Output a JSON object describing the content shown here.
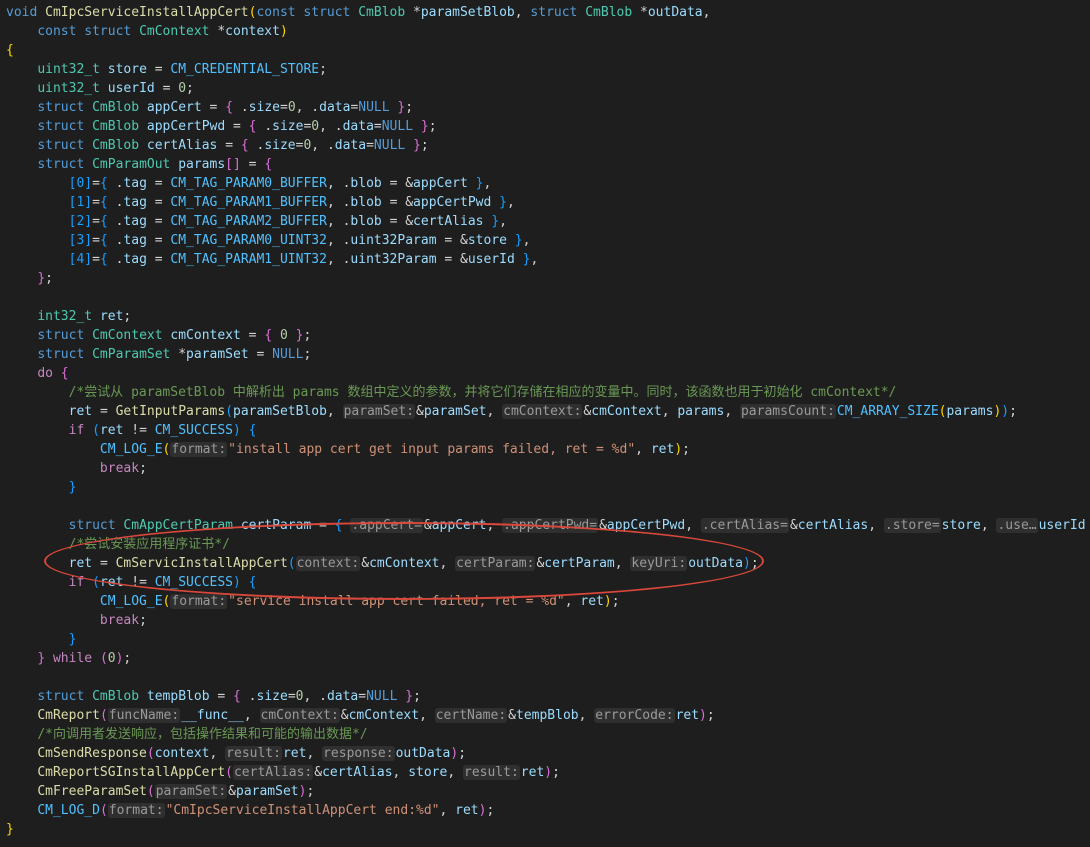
{
  "colors": {
    "kw": "#569cd6",
    "type": "#4ec9b0",
    "fn": "#dcdcaa",
    "var": "#9cdcfe",
    "macro": "#4fc1ff",
    "str": "#ce9178",
    "num": "#b5cea8",
    "comment": "#6a9955",
    "ctrl": "#c586c0",
    "plain": "#d4d4d4",
    "brace1": "#ffd700",
    "brace2": "#da70d6",
    "brace3": "#179fff",
    "annotation": "#d9483b"
  },
  "lines": [
    [
      [
        "kw",
        "void "
      ],
      [
        "fn",
        "CmIpcServiceInstallAppCert"
      ],
      [
        "brace1",
        "("
      ],
      [
        "kw",
        "const struct "
      ],
      [
        "type",
        "CmBlob "
      ],
      [
        "plain",
        "*"
      ],
      [
        "var",
        "paramSetBlob"
      ],
      [
        "plain",
        ", "
      ],
      [
        "kw",
        "struct "
      ],
      [
        "type",
        "CmBlob "
      ],
      [
        "plain",
        "*"
      ],
      [
        "var",
        "outData"
      ],
      [
        "plain",
        ","
      ]
    ],
    [
      [
        "plain",
        "    "
      ],
      [
        "kw",
        "const struct "
      ],
      [
        "type",
        "CmContext "
      ],
      [
        "plain",
        "*"
      ],
      [
        "var",
        "context"
      ],
      [
        "brace1",
        ")"
      ]
    ],
    [
      [
        "brace1",
        "{"
      ]
    ],
    [
      [
        "plain",
        "    "
      ],
      [
        "type",
        "uint32_t "
      ],
      [
        "var",
        "store "
      ],
      [
        "plain",
        "= "
      ],
      [
        "macro",
        "CM_CREDENTIAL_STORE"
      ],
      [
        "plain",
        ";"
      ]
    ],
    [
      [
        "plain",
        "    "
      ],
      [
        "type",
        "uint32_t "
      ],
      [
        "var",
        "userId "
      ],
      [
        "plain",
        "= "
      ],
      [
        "num",
        "0"
      ],
      [
        "plain",
        ";"
      ]
    ],
    [
      [
        "plain",
        "    "
      ],
      [
        "kw",
        "struct "
      ],
      [
        "type",
        "CmBlob "
      ],
      [
        "var",
        "appCert "
      ],
      [
        "plain",
        "= "
      ],
      [
        "brace2",
        "{ "
      ],
      [
        "plain",
        "."
      ],
      [
        "var",
        "size"
      ],
      [
        "plain",
        "="
      ],
      [
        "num",
        "0"
      ],
      [
        "plain",
        ", ."
      ],
      [
        "var",
        "data"
      ],
      [
        "plain",
        "="
      ],
      [
        "kw",
        "NULL "
      ],
      [
        "brace2",
        "}"
      ],
      [
        "plain",
        ";"
      ]
    ],
    [
      [
        "plain",
        "    "
      ],
      [
        "kw",
        "struct "
      ],
      [
        "type",
        "CmBlob "
      ],
      [
        "var",
        "appCertPwd "
      ],
      [
        "plain",
        "= "
      ],
      [
        "brace2",
        "{ "
      ],
      [
        "plain",
        "."
      ],
      [
        "var",
        "size"
      ],
      [
        "plain",
        "="
      ],
      [
        "num",
        "0"
      ],
      [
        "plain",
        ", ."
      ],
      [
        "var",
        "data"
      ],
      [
        "plain",
        "="
      ],
      [
        "kw",
        "NULL "
      ],
      [
        "brace2",
        "}"
      ],
      [
        "plain",
        ";"
      ]
    ],
    [
      [
        "plain",
        "    "
      ],
      [
        "kw",
        "struct "
      ],
      [
        "type",
        "CmBlob "
      ],
      [
        "var",
        "certAlias "
      ],
      [
        "plain",
        "= "
      ],
      [
        "brace2",
        "{ "
      ],
      [
        "plain",
        "."
      ],
      [
        "var",
        "size"
      ],
      [
        "plain",
        "="
      ],
      [
        "num",
        "0"
      ],
      [
        "plain",
        ", ."
      ],
      [
        "var",
        "data"
      ],
      [
        "plain",
        "="
      ],
      [
        "kw",
        "NULL "
      ],
      [
        "brace2",
        "}"
      ],
      [
        "plain",
        ";"
      ]
    ],
    [
      [
        "plain",
        "    "
      ],
      [
        "kw",
        "struct "
      ],
      [
        "type",
        "CmParamOut "
      ],
      [
        "var",
        "params"
      ],
      [
        "brace2",
        "[]"
      ],
      [
        "plain",
        " = "
      ],
      [
        "brace2",
        "{"
      ]
    ],
    [
      [
        "plain",
        "        "
      ],
      [
        "brace3",
        "[0]"
      ],
      [
        "plain",
        "="
      ],
      [
        "brace3",
        "{ "
      ],
      [
        "plain",
        "."
      ],
      [
        "var",
        "tag "
      ],
      [
        "plain",
        "= "
      ],
      [
        "macro",
        "CM_TAG_PARAM0_BUFFER"
      ],
      [
        "plain",
        ", ."
      ],
      [
        "var",
        "blob "
      ],
      [
        "plain",
        "= &"
      ],
      [
        "var",
        "appCert "
      ],
      [
        "brace3",
        "}"
      ],
      [
        "plain",
        ","
      ]
    ],
    [
      [
        "plain",
        "        "
      ],
      [
        "brace3",
        "[1]"
      ],
      [
        "plain",
        "="
      ],
      [
        "brace3",
        "{ "
      ],
      [
        "plain",
        "."
      ],
      [
        "var",
        "tag "
      ],
      [
        "plain",
        "= "
      ],
      [
        "macro",
        "CM_TAG_PARAM1_BUFFER"
      ],
      [
        "plain",
        ", ."
      ],
      [
        "var",
        "blob "
      ],
      [
        "plain",
        "= &"
      ],
      [
        "var",
        "appCertPwd "
      ],
      [
        "brace3",
        "}"
      ],
      [
        "plain",
        ","
      ]
    ],
    [
      [
        "plain",
        "        "
      ],
      [
        "brace3",
        "[2]"
      ],
      [
        "plain",
        "="
      ],
      [
        "brace3",
        "{ "
      ],
      [
        "plain",
        "."
      ],
      [
        "var",
        "tag "
      ],
      [
        "plain",
        "= "
      ],
      [
        "macro",
        "CM_TAG_PARAM2_BUFFER"
      ],
      [
        "plain",
        ", ."
      ],
      [
        "var",
        "blob "
      ],
      [
        "plain",
        "= &"
      ],
      [
        "var",
        "certAlias "
      ],
      [
        "brace3",
        "}"
      ],
      [
        "plain",
        ","
      ]
    ],
    [
      [
        "plain",
        "        "
      ],
      [
        "brace3",
        "[3]"
      ],
      [
        "plain",
        "="
      ],
      [
        "brace3",
        "{ "
      ],
      [
        "plain",
        "."
      ],
      [
        "var",
        "tag "
      ],
      [
        "plain",
        "= "
      ],
      [
        "macro",
        "CM_TAG_PARAM0_UINT32"
      ],
      [
        "plain",
        ", ."
      ],
      [
        "var",
        "uint32Param "
      ],
      [
        "plain",
        "= &"
      ],
      [
        "var",
        "store "
      ],
      [
        "brace3",
        "}"
      ],
      [
        "plain",
        ","
      ]
    ],
    [
      [
        "plain",
        "        "
      ],
      [
        "brace3",
        "[4]"
      ],
      [
        "plain",
        "="
      ],
      [
        "brace3",
        "{ "
      ],
      [
        "plain",
        "."
      ],
      [
        "var",
        "tag "
      ],
      [
        "plain",
        "= "
      ],
      [
        "macro",
        "CM_TAG_PARAM1_UINT32"
      ],
      [
        "plain",
        ", ."
      ],
      [
        "var",
        "uint32Param "
      ],
      [
        "plain",
        "= &"
      ],
      [
        "var",
        "userId "
      ],
      [
        "brace3",
        "}"
      ],
      [
        "plain",
        ","
      ]
    ],
    [
      [
        "plain",
        "    "
      ],
      [
        "brace2",
        "}"
      ],
      [
        "plain",
        ";"
      ]
    ],
    [],
    [
      [
        "plain",
        "    "
      ],
      [
        "type",
        "int32_t "
      ],
      [
        "var",
        "ret"
      ],
      [
        "plain",
        ";"
      ]
    ],
    [
      [
        "plain",
        "    "
      ],
      [
        "kw",
        "struct "
      ],
      [
        "type",
        "CmContext "
      ],
      [
        "var",
        "cmContext "
      ],
      [
        "plain",
        "= "
      ],
      [
        "brace2",
        "{ "
      ],
      [
        "num",
        "0 "
      ],
      [
        "brace2",
        "}"
      ],
      [
        "plain",
        ";"
      ]
    ],
    [
      [
        "plain",
        "    "
      ],
      [
        "kw",
        "struct "
      ],
      [
        "type",
        "CmParamSet "
      ],
      [
        "plain",
        "*"
      ],
      [
        "var",
        "paramSet "
      ],
      [
        "plain",
        "= "
      ],
      [
        "kw",
        "NULL"
      ],
      [
        "plain",
        ";"
      ]
    ],
    [
      [
        "plain",
        "    "
      ],
      [
        "ctrl",
        "do "
      ],
      [
        "brace2",
        "{"
      ]
    ],
    [
      [
        "plain",
        "        "
      ],
      [
        "comment",
        "/*尝试从 paramSetBlob 中解析出 params 数组中定义的参数，并将它们存储在相应的变量中。同时，该函数也用于初始化 cmContext*/"
      ]
    ],
    [
      [
        "plain",
        "        "
      ],
      [
        "var",
        "ret "
      ],
      [
        "plain",
        "= "
      ],
      [
        "fn",
        "GetInputParams"
      ],
      [
        "brace3",
        "("
      ],
      [
        "var",
        "paramSetBlob"
      ],
      [
        "plain",
        ", "
      ],
      [
        "hint",
        "paramSet:"
      ],
      [
        "plain",
        "&"
      ],
      [
        "var",
        "paramSet"
      ],
      [
        "plain",
        ", "
      ],
      [
        "hint",
        "cmContext:"
      ],
      [
        "plain",
        "&"
      ],
      [
        "var",
        "cmContext"
      ],
      [
        "plain",
        ", "
      ],
      [
        "var",
        "params"
      ],
      [
        "plain",
        ", "
      ],
      [
        "hint",
        "paramsCount:"
      ],
      [
        "macro",
        "CM_ARRAY_SIZE"
      ],
      [
        "brace1",
        "("
      ],
      [
        "var",
        "params"
      ],
      [
        "brace1",
        ")"
      ],
      [
        "brace3",
        ")"
      ],
      [
        "plain",
        ";"
      ]
    ],
    [
      [
        "plain",
        "        "
      ],
      [
        "ctrl",
        "if "
      ],
      [
        "brace3",
        "("
      ],
      [
        "var",
        "ret "
      ],
      [
        "plain",
        "!= "
      ],
      [
        "macro",
        "CM_SUCCESS"
      ],
      [
        "brace3",
        ") {"
      ]
    ],
    [
      [
        "plain",
        "            "
      ],
      [
        "macro",
        "CM_LOG_E"
      ],
      [
        "brace1",
        "("
      ],
      [
        "hint",
        "format:"
      ],
      [
        "str",
        "\"install app cert get input params failed, ret = %d\""
      ],
      [
        "plain",
        ", "
      ],
      [
        "var",
        "ret"
      ],
      [
        "brace1",
        ")"
      ],
      [
        "plain",
        ";"
      ]
    ],
    [
      [
        "plain",
        "            "
      ],
      [
        "ctrl",
        "break"
      ],
      [
        "plain",
        ";"
      ]
    ],
    [
      [
        "plain",
        "        "
      ],
      [
        "brace3",
        "}"
      ]
    ],
    [],
    [
      [
        "plain",
        "        "
      ],
      [
        "kw",
        "struct "
      ],
      [
        "type",
        "CmAppCertParam "
      ],
      [
        "var",
        "certParam "
      ],
      [
        "plain",
        "= "
      ],
      [
        "brace3",
        "{ "
      ],
      [
        "hint",
        ".appCert="
      ],
      [
        "plain",
        "&"
      ],
      [
        "var",
        "appCert"
      ],
      [
        "plain",
        ", "
      ],
      [
        "hint",
        ".appCertPwd="
      ],
      [
        "plain",
        "&"
      ],
      [
        "var",
        "appCertPwd"
      ],
      [
        "plain",
        ", "
      ],
      [
        "hint",
        ".certAlias="
      ],
      [
        "plain",
        "&"
      ],
      [
        "var",
        "certAlias"
      ],
      [
        "plain",
        ", "
      ],
      [
        "hint",
        ".store="
      ],
      [
        "var",
        "store"
      ],
      [
        "plain",
        ", "
      ],
      [
        "hint",
        ".use…"
      ],
      [
        "var",
        "userId "
      ],
      [
        "brace3",
        "}"
      ],
      [
        "plain",
        ";"
      ]
    ],
    [
      [
        "plain",
        "        "
      ],
      [
        "comment",
        "/*尝试安装应用程序证书*/"
      ]
    ],
    [
      [
        "plain",
        "        "
      ],
      [
        "var",
        "ret "
      ],
      [
        "plain",
        "= "
      ],
      [
        "fn",
        "CmServicInstallAppCert"
      ],
      [
        "brace3",
        "("
      ],
      [
        "hint",
        "context:"
      ],
      [
        "plain",
        "&"
      ],
      [
        "var",
        "cmContext"
      ],
      [
        "plain",
        ", "
      ],
      [
        "hint",
        "certParam:"
      ],
      [
        "plain",
        "&"
      ],
      [
        "var",
        "certParam"
      ],
      [
        "plain",
        ", "
      ],
      [
        "hint",
        "keyUri:"
      ],
      [
        "var",
        "outData"
      ],
      [
        "brace3",
        ")"
      ],
      [
        "plain",
        ";"
      ]
    ],
    [
      [
        "plain",
        "        "
      ],
      [
        "ctrl",
        "if "
      ],
      [
        "brace3",
        "("
      ],
      [
        "var",
        "ret "
      ],
      [
        "plain",
        "!= "
      ],
      [
        "macro",
        "CM_SUCCESS"
      ],
      [
        "brace3",
        ") {"
      ]
    ],
    [
      [
        "plain",
        "            "
      ],
      [
        "macro",
        "CM_LOG_E"
      ],
      [
        "brace1",
        "("
      ],
      [
        "hint",
        "format:"
      ],
      [
        "str",
        "\"service install app cert failed, ret = %d\""
      ],
      [
        "plain",
        ", "
      ],
      [
        "var",
        "ret"
      ],
      [
        "brace1",
        ")"
      ],
      [
        "plain",
        ";"
      ]
    ],
    [
      [
        "plain",
        "            "
      ],
      [
        "ctrl",
        "break"
      ],
      [
        "plain",
        ";"
      ]
    ],
    [
      [
        "plain",
        "        "
      ],
      [
        "brace3",
        "}"
      ]
    ],
    [
      [
        "plain",
        "    "
      ],
      [
        "brace2",
        "} "
      ],
      [
        "ctrl",
        "while "
      ],
      [
        "brace2",
        "("
      ],
      [
        "num",
        "0"
      ],
      [
        "brace2",
        ")"
      ],
      [
        "plain",
        ";"
      ]
    ],
    [],
    [
      [
        "plain",
        "    "
      ],
      [
        "kw",
        "struct "
      ],
      [
        "type",
        "CmBlob "
      ],
      [
        "var",
        "tempBlob "
      ],
      [
        "plain",
        "= "
      ],
      [
        "brace2",
        "{ "
      ],
      [
        "plain",
        "."
      ],
      [
        "var",
        "size"
      ],
      [
        "plain",
        "="
      ],
      [
        "num",
        "0"
      ],
      [
        "plain",
        ", ."
      ],
      [
        "var",
        "data"
      ],
      [
        "plain",
        "="
      ],
      [
        "kw",
        "NULL "
      ],
      [
        "brace2",
        "}"
      ],
      [
        "plain",
        ";"
      ]
    ],
    [
      [
        "plain",
        "    "
      ],
      [
        "fn",
        "CmReport"
      ],
      [
        "brace2",
        "("
      ],
      [
        "hint",
        "funcName:"
      ],
      [
        "var",
        "__func__"
      ],
      [
        "plain",
        ", "
      ],
      [
        "hint",
        "cmContext:"
      ],
      [
        "plain",
        "&"
      ],
      [
        "var",
        "cmContext"
      ],
      [
        "plain",
        ", "
      ],
      [
        "hint",
        "certName:"
      ],
      [
        "plain",
        "&"
      ],
      [
        "var",
        "tempBlob"
      ],
      [
        "plain",
        ", "
      ],
      [
        "hint",
        "errorCode:"
      ],
      [
        "var",
        "ret"
      ],
      [
        "brace2",
        ")"
      ],
      [
        "plain",
        ";"
      ]
    ],
    [
      [
        "plain",
        "    "
      ],
      [
        "comment",
        "/*向调用者发送响应，包括操作结果和可能的输出数据*/"
      ]
    ],
    [
      [
        "plain",
        "    "
      ],
      [
        "fn",
        "CmSendResponse"
      ],
      [
        "brace2",
        "("
      ],
      [
        "var",
        "context"
      ],
      [
        "plain",
        ", "
      ],
      [
        "hint",
        "result:"
      ],
      [
        "var",
        "ret"
      ],
      [
        "plain",
        ", "
      ],
      [
        "hint",
        "response:"
      ],
      [
        "var",
        "outData"
      ],
      [
        "brace2",
        ")"
      ],
      [
        "plain",
        ";"
      ]
    ],
    [
      [
        "plain",
        "    "
      ],
      [
        "fn",
        "CmReportSGInstallAppCert"
      ],
      [
        "brace2",
        "("
      ],
      [
        "hint",
        "certAlias:"
      ],
      [
        "plain",
        "&"
      ],
      [
        "var",
        "certAlias"
      ],
      [
        "plain",
        ", "
      ],
      [
        "var",
        "store"
      ],
      [
        "plain",
        ", "
      ],
      [
        "hint",
        "result:"
      ],
      [
        "var",
        "ret"
      ],
      [
        "brace2",
        ")"
      ],
      [
        "plain",
        ";"
      ]
    ],
    [
      [
        "plain",
        "    "
      ],
      [
        "fn",
        "CmFreeParamSet"
      ],
      [
        "brace2",
        "("
      ],
      [
        "hint",
        "paramSet:"
      ],
      [
        "plain",
        "&"
      ],
      [
        "var",
        "paramSet"
      ],
      [
        "brace2",
        ")"
      ],
      [
        "plain",
        ";"
      ]
    ],
    [
      [
        "plain",
        "    "
      ],
      [
        "macro",
        "CM_LOG_D"
      ],
      [
        "brace2",
        "("
      ],
      [
        "hint",
        "format:"
      ],
      [
        "str",
        "\"CmIpcServiceInstallAppCert end:%d\""
      ],
      [
        "plain",
        ", "
      ],
      [
        "var",
        "ret"
      ],
      [
        "brace2",
        ")"
      ],
      [
        "plain",
        ";"
      ]
    ],
    [
      [
        "brace1",
        "}"
      ]
    ]
  ]
}
